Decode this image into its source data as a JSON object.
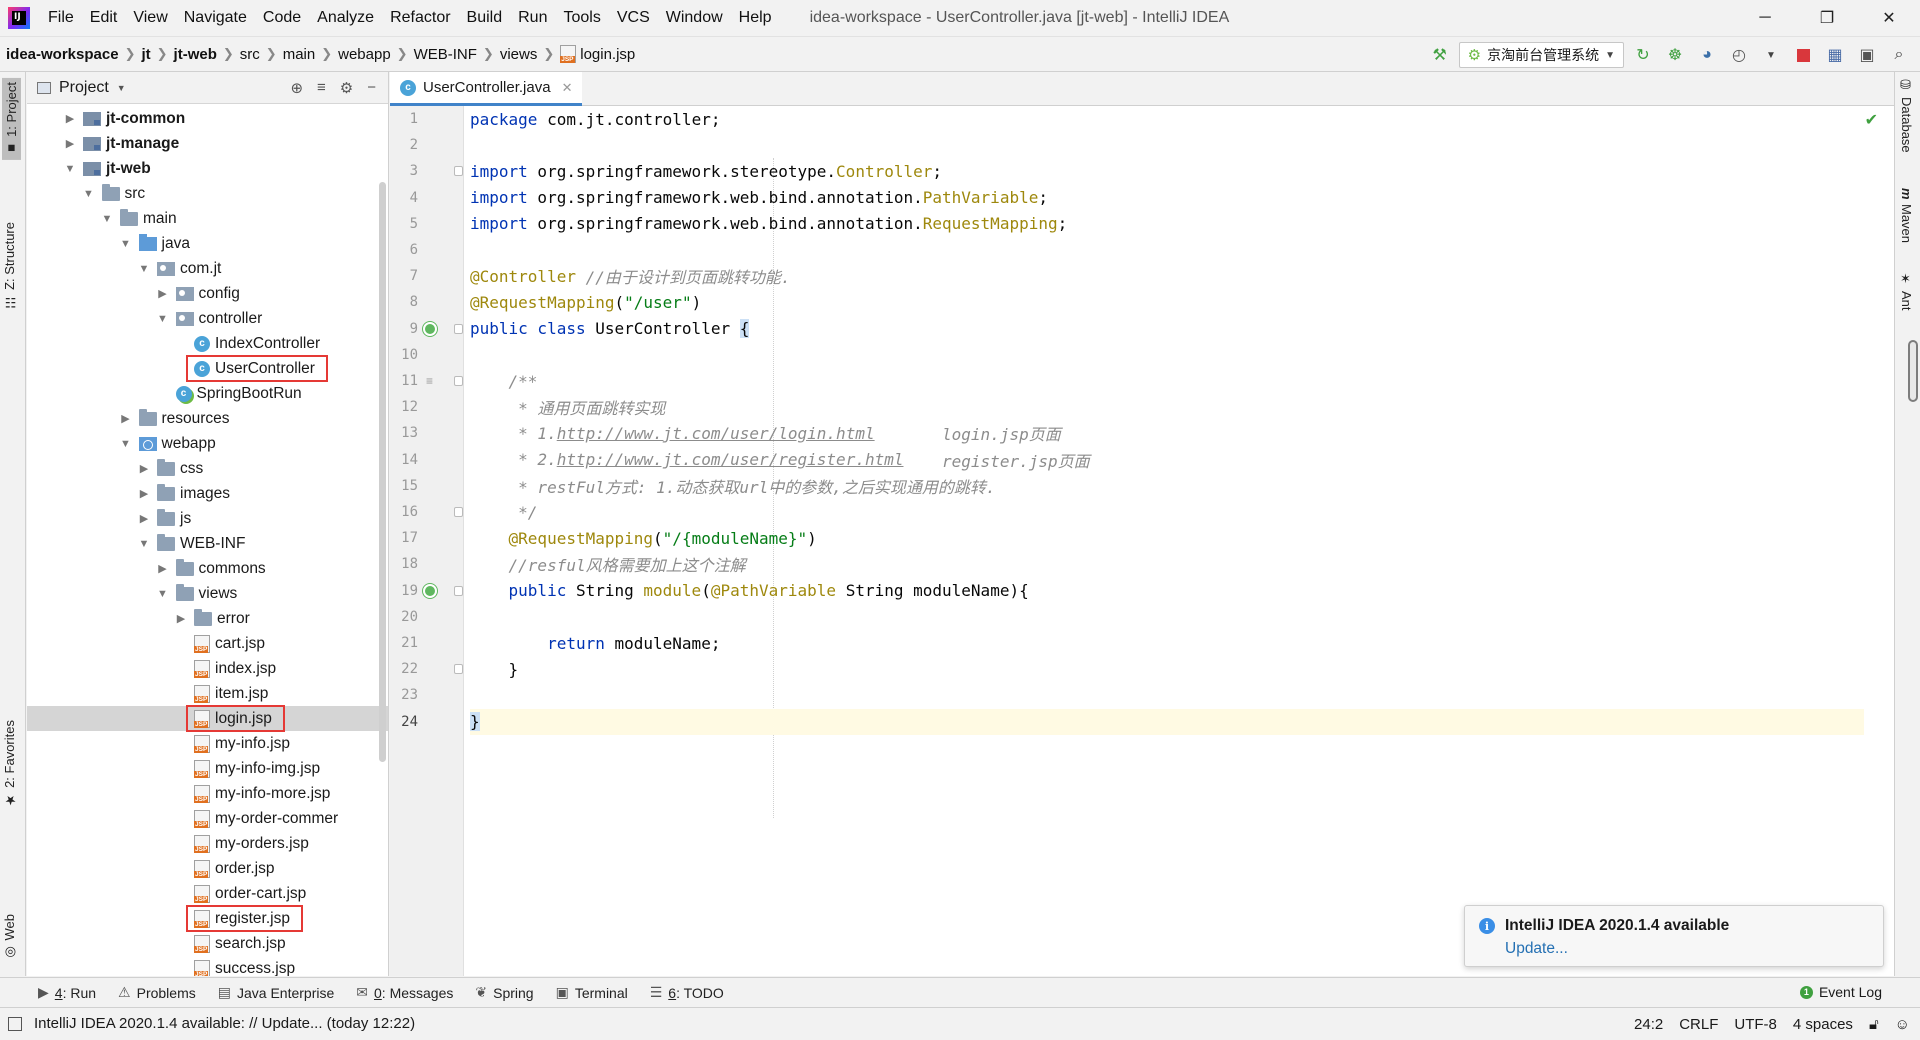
{
  "menubar": {
    "items": [
      "File",
      "Edit",
      "View",
      "Navigate",
      "Code",
      "Analyze",
      "Refactor",
      "Build",
      "Run",
      "Tools",
      "VCS",
      "Window",
      "Help"
    ],
    "window_title": "idea-workspace - UserController.java [jt-web] - IntelliJ IDEA"
  },
  "breadcrumb": [
    "idea-workspace",
    "jt",
    "jt-web",
    "src",
    "main",
    "webapp",
    "WEB-INF",
    "views",
    "login.jsp"
  ],
  "toolbar": {
    "run_config": "京淘前台管理系统"
  },
  "left_stripe": {
    "project": "1: Project",
    "structure": "Z: Structure",
    "favorites": "2: Favorites",
    "web": "Web"
  },
  "right_stripe": {
    "database": "Database",
    "maven": "Maven",
    "ant": "Ant"
  },
  "project_panel": {
    "title": "Project",
    "tree": [
      {
        "label": "jt-common",
        "depth": 0,
        "arrow": "right",
        "icon": "module",
        "bold": true
      },
      {
        "label": "jt-manage",
        "depth": 0,
        "arrow": "right",
        "icon": "module",
        "bold": true
      },
      {
        "label": "jt-web",
        "depth": 0,
        "arrow": "down",
        "icon": "module",
        "bold": true
      },
      {
        "label": "src",
        "depth": 1,
        "arrow": "down",
        "icon": "folder"
      },
      {
        "label": "main",
        "depth": 2,
        "arrow": "down",
        "icon": "folder"
      },
      {
        "label": "java",
        "depth": 3,
        "arrow": "down",
        "icon": "srcfolder"
      },
      {
        "label": "com.jt",
        "depth": 4,
        "arrow": "down",
        "icon": "pkg"
      },
      {
        "label": "config",
        "depth": 5,
        "arrow": "right",
        "icon": "pkg"
      },
      {
        "label": "controller",
        "depth": 5,
        "arrow": "down",
        "icon": "pkg"
      },
      {
        "label": "IndexController",
        "depth": 6,
        "arrow": "",
        "icon": "cls"
      },
      {
        "label": "UserController",
        "depth": 6,
        "arrow": "",
        "icon": "cls",
        "highlight": true
      },
      {
        "label": "SpringBootRun",
        "depth": 5,
        "arrow": "",
        "icon": "boot"
      },
      {
        "label": "resources",
        "depth": 3,
        "arrow": "right",
        "icon": "folder"
      },
      {
        "label": "webapp",
        "depth": 3,
        "arrow": "down",
        "icon": "web"
      },
      {
        "label": "css",
        "depth": 4,
        "arrow": "right",
        "icon": "folder"
      },
      {
        "label": "images",
        "depth": 4,
        "arrow": "right",
        "icon": "folder"
      },
      {
        "label": "js",
        "depth": 4,
        "arrow": "right",
        "icon": "folder"
      },
      {
        "label": "WEB-INF",
        "depth": 4,
        "arrow": "down",
        "icon": "folder"
      },
      {
        "label": "commons",
        "depth": 5,
        "arrow": "right",
        "icon": "folder"
      },
      {
        "label": "views",
        "depth": 5,
        "arrow": "down",
        "icon": "folder"
      },
      {
        "label": "error",
        "depth": 6,
        "arrow": "right",
        "icon": "folder"
      },
      {
        "label": "cart.jsp",
        "depth": 6,
        "arrow": "",
        "icon": "jsp"
      },
      {
        "label": "index.jsp",
        "depth": 6,
        "arrow": "",
        "icon": "jsp"
      },
      {
        "label": "item.jsp",
        "depth": 6,
        "arrow": "",
        "icon": "jsp"
      },
      {
        "label": "login.jsp",
        "depth": 6,
        "arrow": "",
        "icon": "jsp",
        "selected": true,
        "highlight": true
      },
      {
        "label": "my-info.jsp",
        "depth": 6,
        "arrow": "",
        "icon": "jsp"
      },
      {
        "label": "my-info-img.jsp",
        "depth": 6,
        "arrow": "",
        "icon": "jsp"
      },
      {
        "label": "my-info-more.jsp",
        "depth": 6,
        "arrow": "",
        "icon": "jsp"
      },
      {
        "label": "my-order-commer",
        "depth": 6,
        "arrow": "",
        "icon": "jsp"
      },
      {
        "label": "my-orders.jsp",
        "depth": 6,
        "arrow": "",
        "icon": "jsp"
      },
      {
        "label": "order.jsp",
        "depth": 6,
        "arrow": "",
        "icon": "jsp"
      },
      {
        "label": "order-cart.jsp",
        "depth": 6,
        "arrow": "",
        "icon": "jsp"
      },
      {
        "label": "register.jsp",
        "depth": 6,
        "arrow": "",
        "icon": "jsp",
        "highlight": true
      },
      {
        "label": "search.jsp",
        "depth": 6,
        "arrow": "",
        "icon": "jsp"
      },
      {
        "label": "success.jsp",
        "depth": 6,
        "arrow": "",
        "icon": "jsp"
      }
    ]
  },
  "editor": {
    "tab": "UserController.java",
    "current_line": 24,
    "lines": [
      [
        [
          "kw",
          "package"
        ],
        [
          "id",
          " com.jt.controller;"
        ]
      ],
      [],
      [
        [
          "kw",
          "import"
        ],
        [
          "id",
          " org.springframework.stereotype."
        ],
        [
          "ann",
          "Controller"
        ],
        [
          "id",
          ";"
        ]
      ],
      [
        [
          "kw",
          "import"
        ],
        [
          "id",
          " org.springframework.web.bind.annotation."
        ],
        [
          "ann",
          "PathVariable"
        ],
        [
          "id",
          ";"
        ]
      ],
      [
        [
          "kw",
          "import"
        ],
        [
          "id",
          " org.springframework.web.bind.annotation."
        ],
        [
          "ann",
          "RequestMapping"
        ],
        [
          "id",
          ";"
        ]
      ],
      [],
      [
        [
          "ann",
          "@Controller"
        ],
        [
          "id",
          " "
        ],
        [
          "com",
          "//由于设计到页面跳转功能."
        ]
      ],
      [
        [
          "ann",
          "@RequestMapping"
        ],
        [
          "id",
          "("
        ],
        [
          "str",
          "\"/user\""
        ],
        [
          "id",
          ")"
        ]
      ],
      [
        [
          "kw",
          "public class"
        ],
        [
          "id",
          " UserController "
        ],
        [
          "brace",
          "{"
        ]
      ],
      [],
      [
        [
          "doc",
          "    /**"
        ]
      ],
      [
        [
          "doc",
          "     * 通用页面跳转实现"
        ]
      ],
      [
        [
          "doc",
          "     * 1."
        ],
        [
          "link",
          "http://www.jt.com/user/login.html"
        ],
        [
          "doc",
          "       login.jsp页面"
        ]
      ],
      [
        [
          "doc",
          "     * 2."
        ],
        [
          "link",
          "http://www.jt.com/user/register.html"
        ],
        [
          "doc",
          "    register.jsp页面"
        ]
      ],
      [
        [
          "doc",
          "     * restFul方式: 1.动态获取url中的参数,之后实现通用的跳转."
        ]
      ],
      [
        [
          "doc",
          "     */"
        ]
      ],
      [
        [
          "id",
          "    "
        ],
        [
          "ann",
          "@RequestMapping"
        ],
        [
          "id",
          "("
        ],
        [
          "str",
          "\"/{moduleName}\""
        ],
        [
          "id",
          ")"
        ]
      ],
      [
        [
          "id",
          "    "
        ],
        [
          "com",
          "//resful风格需要加上这个注解"
        ]
      ],
      [
        [
          "id",
          "    "
        ],
        [
          "kw",
          "public"
        ],
        [
          "id",
          " String "
        ],
        [
          "ann",
          "module"
        ],
        [
          "id",
          "("
        ],
        [
          "ann",
          "@PathVariable"
        ],
        [
          "id",
          " String moduleName){"
        ]
      ],
      [],
      [
        [
          "id",
          "        "
        ],
        [
          "kw",
          "return"
        ],
        [
          "id",
          " moduleName;"
        ]
      ],
      [
        [
          "id",
          "    }"
        ]
      ],
      [],
      [
        [
          "brace",
          "}"
        ]
      ]
    ],
    "gutter_marks": {
      "run": [
        9,
        19
      ],
      "fold": [
        3,
        9,
        11,
        16,
        19,
        22
      ],
      "bookmark": [
        11
      ]
    }
  },
  "notification": {
    "title": "IntelliJ IDEA 2020.1.4 available",
    "link": "Update..."
  },
  "bottom_tabs": [
    {
      "num": "4",
      "label": ": Run",
      "icon": "run-icon"
    },
    {
      "num": "",
      "label": "Problems",
      "icon": "problems-icon"
    },
    {
      "num": "",
      "label": "Java Enterprise",
      "icon": "java-enterprise-icon"
    },
    {
      "num": "0",
      "label": ": Messages",
      "icon": "messages-icon"
    },
    {
      "num": "",
      "label": "Spring",
      "icon": "spring-icon"
    },
    {
      "num": "",
      "label": "Terminal",
      "icon": "terminal-icon"
    },
    {
      "num": "6",
      "label": ": TODO",
      "icon": "todo-icon"
    }
  ],
  "event_log": "Event Log",
  "status": {
    "message": "IntelliJ IDEA 2020.1.4 available: // Update... (today 12:22)",
    "position": "24:2",
    "line_sep": "CRLF",
    "encoding": "UTF-8",
    "indent": "4 spaces"
  },
  "colors": {
    "keyword": "#0033b3",
    "annotation": "#9e880d",
    "string": "#067d17",
    "comment": "#8c8c8c",
    "highlight_box": "#e53935",
    "current_line": "#fffae3"
  }
}
